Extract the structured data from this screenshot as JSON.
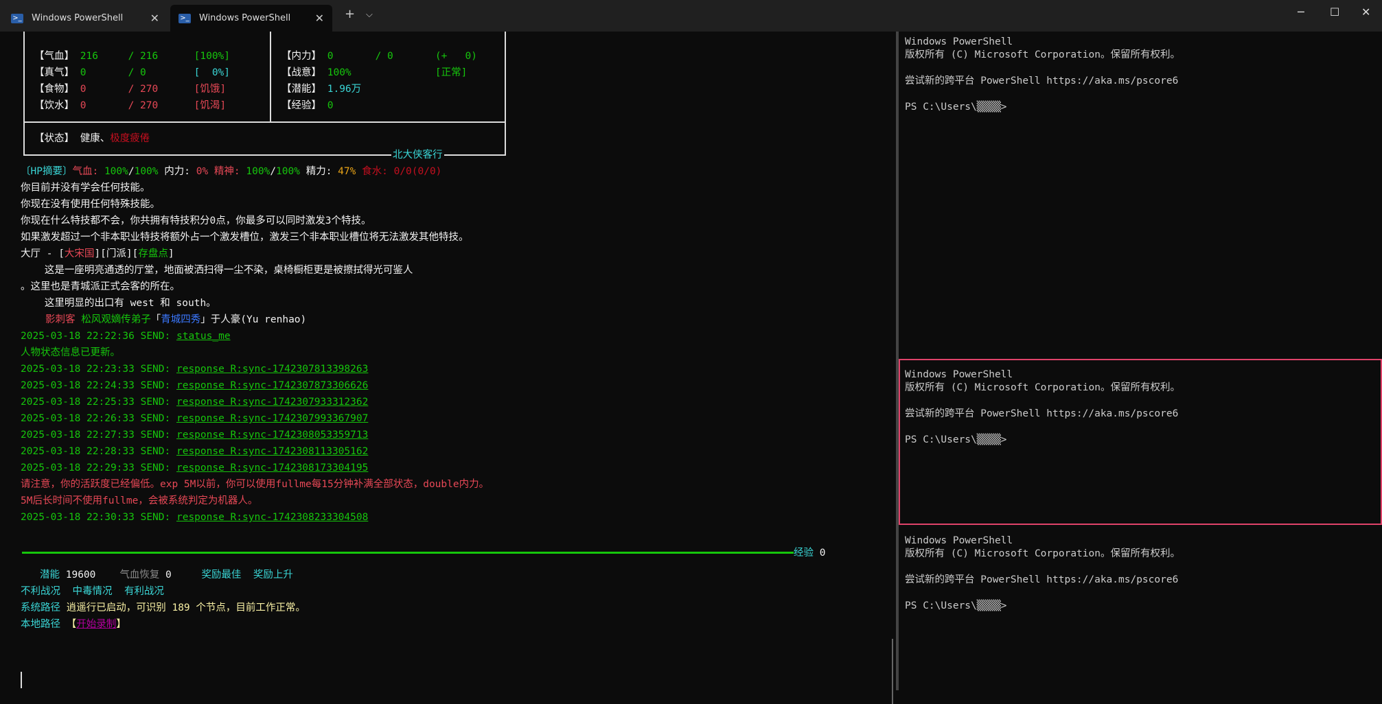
{
  "tabs": [
    {
      "label": "Windows PowerShell"
    },
    {
      "label": "Windows PowerShell"
    }
  ],
  "status": {
    "rows": [
      {
        "l": "【气血】",
        "a": "216",
        "b": "/ 216",
        "c": "[100%]",
        "l2": "【内力】",
        "a2": "0",
        "b2": "/ 0",
        "c2": "(+   0)"
      },
      {
        "l": "【真气】",
        "a": "0",
        "b": "/ 0",
        "c": "[  0%]",
        "l2": "【战意】",
        "a2": "100%",
        "c2": "[正常]"
      },
      {
        "l": "【食物】",
        "a": "0",
        "b": "/ 270",
        "c": "[饥饿]",
        "l2": "【潜能】",
        "a2": "1.96万"
      },
      {
        "l": "【饮水】",
        "a": "0",
        "b": "/ 270",
        "c": "[饥渴]",
        "l2": "【经验】",
        "a2": "0"
      }
    ],
    "state_label": "【状态】",
    "state_a": "健康、",
    "state_b": "极度疲倦",
    "footer": "北大侠客行"
  },
  "hp": {
    "tag": "〔HP摘要〕",
    "qx": "气血:",
    "qxv": "100%",
    "s1": "/",
    "qxm": "100%",
    "nl": "内力:",
    "nlv": "0%",
    "js": "精神:",
    "jsv": "100%",
    "s2": "/",
    "jsm": "100%",
    "jl": "精力:",
    "jlv": "47%",
    "sw": "食水:",
    "swv": "0/0(0/0)"
  },
  "lines": [
    "你目前并没有学会任何技能。",
    "你现在没有使用任何特殊技能。",
    "你现在什么特技都不会，你共拥有特技积分0点，你最多可以同时激发3个特技。",
    "如果激发超过一个非本职业特技将额外占一个激发槽位，激发三个非本职业槽位将无法激发其他特技。"
  ],
  "room": {
    "a": "大厅 - [",
    "b": "大宋国",
    "c": "][门派][",
    "d": "存盘点",
    "e": "]",
    "desc1": "    这是一座明亮通透的厅堂，地面被洒扫得一尘不染，桌椅橱柜更是被擦拭得光可鉴人",
    "desc2": "。这里也是青城派正式会客的所在。",
    "exits": "    这里明显的出口有 west 和 south。",
    "npc_a": "影刺客",
    "npc_b": "松风观嫡传弟子",
    "npc_c": "「",
    "npc_d": "青城四秀",
    "npc_e": "」于人豪(Yu renhao)"
  },
  "sends": [
    {
      "t": "2025-03-18 22:22:36 SEND: ",
      "cmd": "status_me"
    },
    {
      "msg": "人物状态信息已更新。"
    },
    {
      "t": "2025-03-18 22:23:33 SEND: ",
      "cmd": "response R:sync-1742307813398263"
    },
    {
      "t": "2025-03-18 22:24:33 SEND: ",
      "cmd": "response R:sync-1742307873306626"
    },
    {
      "t": "2025-03-18 22:25:33 SEND: ",
      "cmd": "response R:sync-1742307933312362"
    },
    {
      "t": "2025-03-18 22:26:33 SEND: ",
      "cmd": "response R:sync-1742307993367907"
    },
    {
      "t": "2025-03-18 22:27:33 SEND: ",
      "cmd": "response R:sync-1742308053359713"
    },
    {
      "t": "2025-03-18 22:28:33 SEND: ",
      "cmd": "response R:sync-1742308113305162"
    },
    {
      "t": "2025-03-18 22:29:33 SEND: ",
      "cmd": "response R:sync-1742308173304195"
    },
    {
      "warn": "请注意，你的活跃度已经偏低。exp 5M以前，你可以使用fullme每15分钟补满全部状态，double内力。"
    },
    {
      "warn": "5M后长时间不使用fullme，会被系统判定为机器人。"
    },
    {
      "t": "2025-03-18 22:30:33 SEND: ",
      "cmd": "response R:sync-1742308233304508"
    }
  ],
  "bottom": {
    "exp_label": "经验",
    "exp_val": "0",
    "qn_label": "潜能",
    "qn_val": "19600",
    "qx_label": "气血恢复",
    "qx_val": "0",
    "r1": "奖励最佳",
    "r2": "奖励上升",
    "b1": "不利战况",
    "b2": "中毒情况",
    "b3": "有利战况",
    "sys_label": "系统路径",
    "sys_msg": "逍遥行已启动，可识别 189 个节点，目前工作正常。",
    "loc_label": "本地路径",
    "loc_a": "【",
    "loc_b": "开始录制",
    "loc_c": "】"
  },
  "right": {
    "l1": "Windows PowerShell",
    "l2": "版权所有 (C) Microsoft Corporation。保留所有权利。",
    "l3": "尝试新的跨平台 PowerShell https://aka.ms/pscore6",
    "l4": "PS C:\\Users\\▒▒▒▒>"
  }
}
